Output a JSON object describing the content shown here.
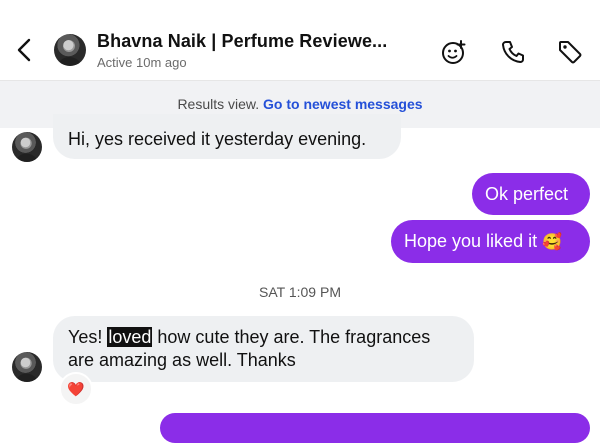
{
  "header": {
    "name": "Bhavna Naik | Perfume Reviewe...",
    "status": "Active 10m ago"
  },
  "banner": {
    "text": "Results view.",
    "link": "Go to newest messages"
  },
  "messages": [
    {
      "from": "them",
      "text": "Hi, yes received it yesterday evening."
    },
    {
      "from": "me",
      "text": "Ok perfect"
    },
    {
      "from": "me",
      "text": "Hope you liked it",
      "emoji": "🥰"
    },
    {
      "from": "them",
      "text_before": "Yes! ",
      "highlight": "loved",
      "text_after": " how cute they are. The fragrances",
      "line2": "are amazing as well. Thanks",
      "reaction": "❤️"
    }
  ],
  "timestamp": "SAT 1:09 PM",
  "colors": {
    "outgoing": "#8b2de8",
    "incoming": "#eef0f2",
    "link": "#2450d8"
  },
  "icons": [
    "chevron-left-icon",
    "sticker-icon",
    "phone-icon",
    "tag-icon"
  ]
}
